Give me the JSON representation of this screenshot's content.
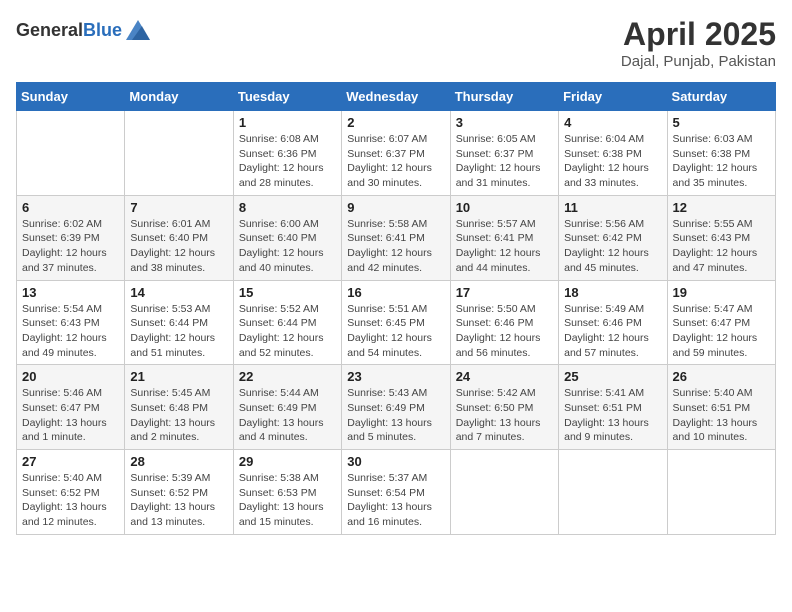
{
  "header": {
    "logo_general": "General",
    "logo_blue": "Blue",
    "title": "April 2025",
    "subtitle": "Dajal, Punjab, Pakistan"
  },
  "days_of_week": [
    "Sunday",
    "Monday",
    "Tuesday",
    "Wednesday",
    "Thursday",
    "Friday",
    "Saturday"
  ],
  "weeks": [
    [
      {
        "day": "",
        "detail": ""
      },
      {
        "day": "",
        "detail": ""
      },
      {
        "day": "1",
        "detail": "Sunrise: 6:08 AM\nSunset: 6:36 PM\nDaylight: 12 hours\nand 28 minutes."
      },
      {
        "day": "2",
        "detail": "Sunrise: 6:07 AM\nSunset: 6:37 PM\nDaylight: 12 hours\nand 30 minutes."
      },
      {
        "day": "3",
        "detail": "Sunrise: 6:05 AM\nSunset: 6:37 PM\nDaylight: 12 hours\nand 31 minutes."
      },
      {
        "day": "4",
        "detail": "Sunrise: 6:04 AM\nSunset: 6:38 PM\nDaylight: 12 hours\nand 33 minutes."
      },
      {
        "day": "5",
        "detail": "Sunrise: 6:03 AM\nSunset: 6:38 PM\nDaylight: 12 hours\nand 35 minutes."
      }
    ],
    [
      {
        "day": "6",
        "detail": "Sunrise: 6:02 AM\nSunset: 6:39 PM\nDaylight: 12 hours\nand 37 minutes."
      },
      {
        "day": "7",
        "detail": "Sunrise: 6:01 AM\nSunset: 6:40 PM\nDaylight: 12 hours\nand 38 minutes."
      },
      {
        "day": "8",
        "detail": "Sunrise: 6:00 AM\nSunset: 6:40 PM\nDaylight: 12 hours\nand 40 minutes."
      },
      {
        "day": "9",
        "detail": "Sunrise: 5:58 AM\nSunset: 6:41 PM\nDaylight: 12 hours\nand 42 minutes."
      },
      {
        "day": "10",
        "detail": "Sunrise: 5:57 AM\nSunset: 6:41 PM\nDaylight: 12 hours\nand 44 minutes."
      },
      {
        "day": "11",
        "detail": "Sunrise: 5:56 AM\nSunset: 6:42 PM\nDaylight: 12 hours\nand 45 minutes."
      },
      {
        "day": "12",
        "detail": "Sunrise: 5:55 AM\nSunset: 6:43 PM\nDaylight: 12 hours\nand 47 minutes."
      }
    ],
    [
      {
        "day": "13",
        "detail": "Sunrise: 5:54 AM\nSunset: 6:43 PM\nDaylight: 12 hours\nand 49 minutes."
      },
      {
        "day": "14",
        "detail": "Sunrise: 5:53 AM\nSunset: 6:44 PM\nDaylight: 12 hours\nand 51 minutes."
      },
      {
        "day": "15",
        "detail": "Sunrise: 5:52 AM\nSunset: 6:44 PM\nDaylight: 12 hours\nand 52 minutes."
      },
      {
        "day": "16",
        "detail": "Sunrise: 5:51 AM\nSunset: 6:45 PM\nDaylight: 12 hours\nand 54 minutes."
      },
      {
        "day": "17",
        "detail": "Sunrise: 5:50 AM\nSunset: 6:46 PM\nDaylight: 12 hours\nand 56 minutes."
      },
      {
        "day": "18",
        "detail": "Sunrise: 5:49 AM\nSunset: 6:46 PM\nDaylight: 12 hours\nand 57 minutes."
      },
      {
        "day": "19",
        "detail": "Sunrise: 5:47 AM\nSunset: 6:47 PM\nDaylight: 12 hours\nand 59 minutes."
      }
    ],
    [
      {
        "day": "20",
        "detail": "Sunrise: 5:46 AM\nSunset: 6:47 PM\nDaylight: 13 hours\nand 1 minute."
      },
      {
        "day": "21",
        "detail": "Sunrise: 5:45 AM\nSunset: 6:48 PM\nDaylight: 13 hours\nand 2 minutes."
      },
      {
        "day": "22",
        "detail": "Sunrise: 5:44 AM\nSunset: 6:49 PM\nDaylight: 13 hours\nand 4 minutes."
      },
      {
        "day": "23",
        "detail": "Sunrise: 5:43 AM\nSunset: 6:49 PM\nDaylight: 13 hours\nand 5 minutes."
      },
      {
        "day": "24",
        "detail": "Sunrise: 5:42 AM\nSunset: 6:50 PM\nDaylight: 13 hours\nand 7 minutes."
      },
      {
        "day": "25",
        "detail": "Sunrise: 5:41 AM\nSunset: 6:51 PM\nDaylight: 13 hours\nand 9 minutes."
      },
      {
        "day": "26",
        "detail": "Sunrise: 5:40 AM\nSunset: 6:51 PM\nDaylight: 13 hours\nand 10 minutes."
      }
    ],
    [
      {
        "day": "27",
        "detail": "Sunrise: 5:40 AM\nSunset: 6:52 PM\nDaylight: 13 hours\nand 12 minutes."
      },
      {
        "day": "28",
        "detail": "Sunrise: 5:39 AM\nSunset: 6:52 PM\nDaylight: 13 hours\nand 13 minutes."
      },
      {
        "day": "29",
        "detail": "Sunrise: 5:38 AM\nSunset: 6:53 PM\nDaylight: 13 hours\nand 15 minutes."
      },
      {
        "day": "30",
        "detail": "Sunrise: 5:37 AM\nSunset: 6:54 PM\nDaylight: 13 hours\nand 16 minutes."
      },
      {
        "day": "",
        "detail": ""
      },
      {
        "day": "",
        "detail": ""
      },
      {
        "day": "",
        "detail": ""
      }
    ]
  ]
}
